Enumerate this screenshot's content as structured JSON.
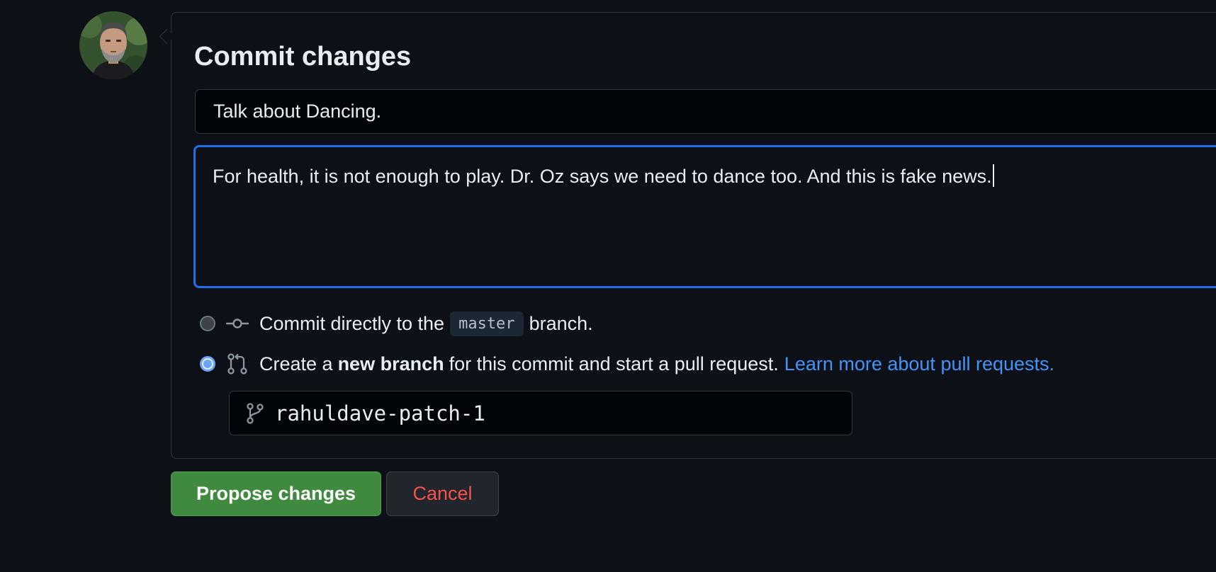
{
  "title": "Commit changes",
  "summary_value": "Talk about Dancing.",
  "description_value": "For health, it is not enough to play. Dr. Oz says we need to dance too. And this is fake news.",
  "options": {
    "direct": {
      "prefix": "Commit directly to the",
      "branch": "master",
      "suffix": "branch.",
      "selected": false
    },
    "new_branch": {
      "prefix": "Create a",
      "bold": "new branch",
      "suffix": "for this commit and start a pull request.",
      "link": "Learn more about pull requests.",
      "selected": true
    }
  },
  "branch_name": "rahuldave-patch-1",
  "buttons": {
    "propose": "Propose changes",
    "cancel": "Cancel"
  },
  "colors": {
    "background": "#0d1117",
    "focus_border": "#1f6feb",
    "link": "#4493f8",
    "propose": "#3f8a3e",
    "cancel_text": "#f85149"
  },
  "icons": {
    "direct": "git-commit-icon",
    "new_branch": "git-pull-request-icon",
    "branch_input": "git-branch-icon"
  }
}
